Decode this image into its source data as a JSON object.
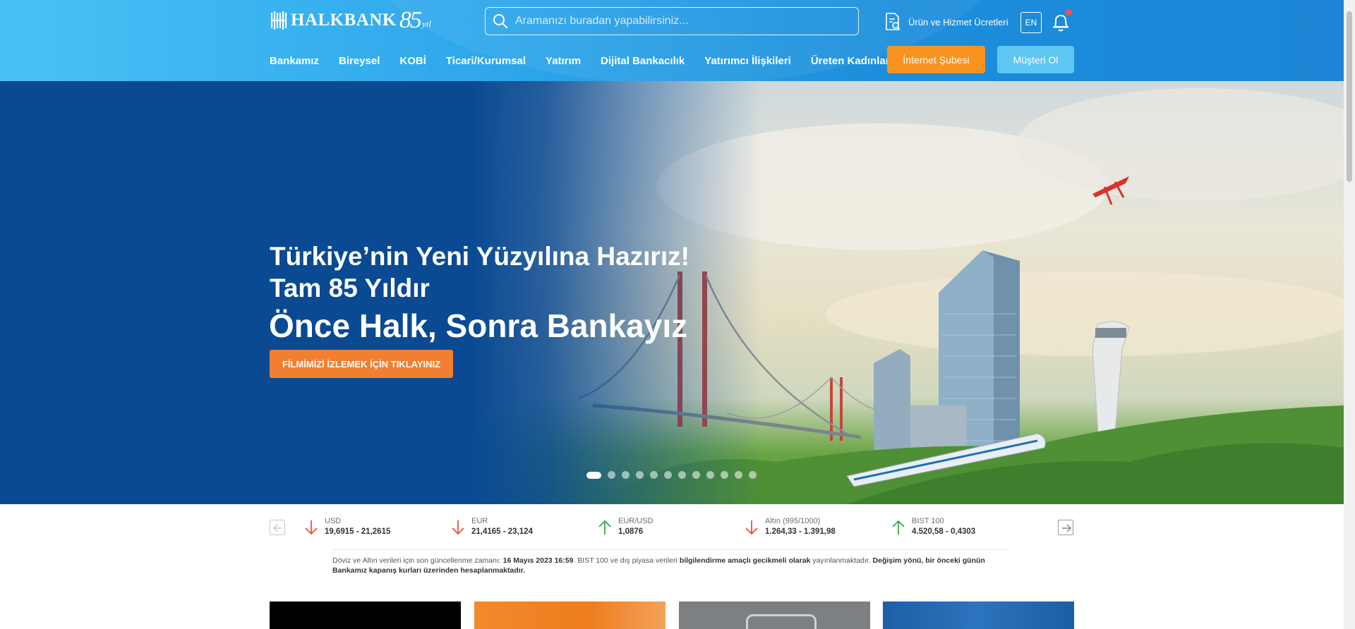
{
  "header": {
    "logo": {
      "brand": "HALKBANK",
      "anniversary_number": "85",
      "anniversary_word": "yıl"
    },
    "search": {
      "placeholder": "Aramanızı buradan yapabilirsiniz..."
    },
    "fees_link": "Ürün ve Hizmet Ücretleri",
    "language_button": "EN",
    "nav": [
      {
        "label": "Bankamız"
      },
      {
        "label": "Bireysel"
      },
      {
        "label": "KOBİ"
      },
      {
        "label": "Ticari/Kurumsal"
      },
      {
        "label": "Yatırım"
      },
      {
        "label": "Dijital Bankacılık"
      },
      {
        "label": "Yatırımcı İlişkileri"
      },
      {
        "label": "Üreten Kadınlar"
      }
    ],
    "internet_branch_button": "İnternet Şubesi",
    "become_customer_button": "Müşteri Ol"
  },
  "hero": {
    "line1": "Türkiye’nin Yeni Yüzyılına Hazırız!",
    "line2": "Tam 85 Yıldır",
    "line3": "Önce Halk, Sonra Bankayız",
    "cta": "FİLMİMİZİ İZLEMEK İÇİN TIKLAYINIZ",
    "slide_count": 12,
    "active_slide": 1
  },
  "ticker": {
    "rates": [
      {
        "name": "USD",
        "value": "19,6915 - 21,2615",
        "direction": "down"
      },
      {
        "name": "EUR",
        "value": "21,4165 - 23,124",
        "direction": "down"
      },
      {
        "name": "EUR/USD",
        "value": "1,0876",
        "direction": "up"
      },
      {
        "name": "Altın (995/1000)",
        "value": "1.264,33 - 1.391,98",
        "direction": "down"
      },
      {
        "name": "BIST 100",
        "value": "4.520,58 - 0,4303",
        "direction": "up"
      }
    ],
    "note": {
      "part1": "Döviz ve Altın verileri için son güncellenme zamanı: ",
      "timestamp": "16 Mayıs 2023 16:59",
      "part2": ". BIST 100 ve dış piyasa verileri ",
      "bold1": "bilgilendirme amaçlı gecikmeli olarak",
      "part3": " yayınlanmaktadır. ",
      "bold2": "Değişim yönü, bir önceki günün Bankamız kapanış kurları üzerinden hesaplanmaktadır."
    }
  },
  "colors": {
    "header_blue": "#2fa8ec",
    "hero_blue": "#0a4a93",
    "orange": "#f7931e",
    "light_blue_button": "#5ec6f1",
    "down_red": "#e8513f",
    "up_green": "#2eae4f"
  }
}
